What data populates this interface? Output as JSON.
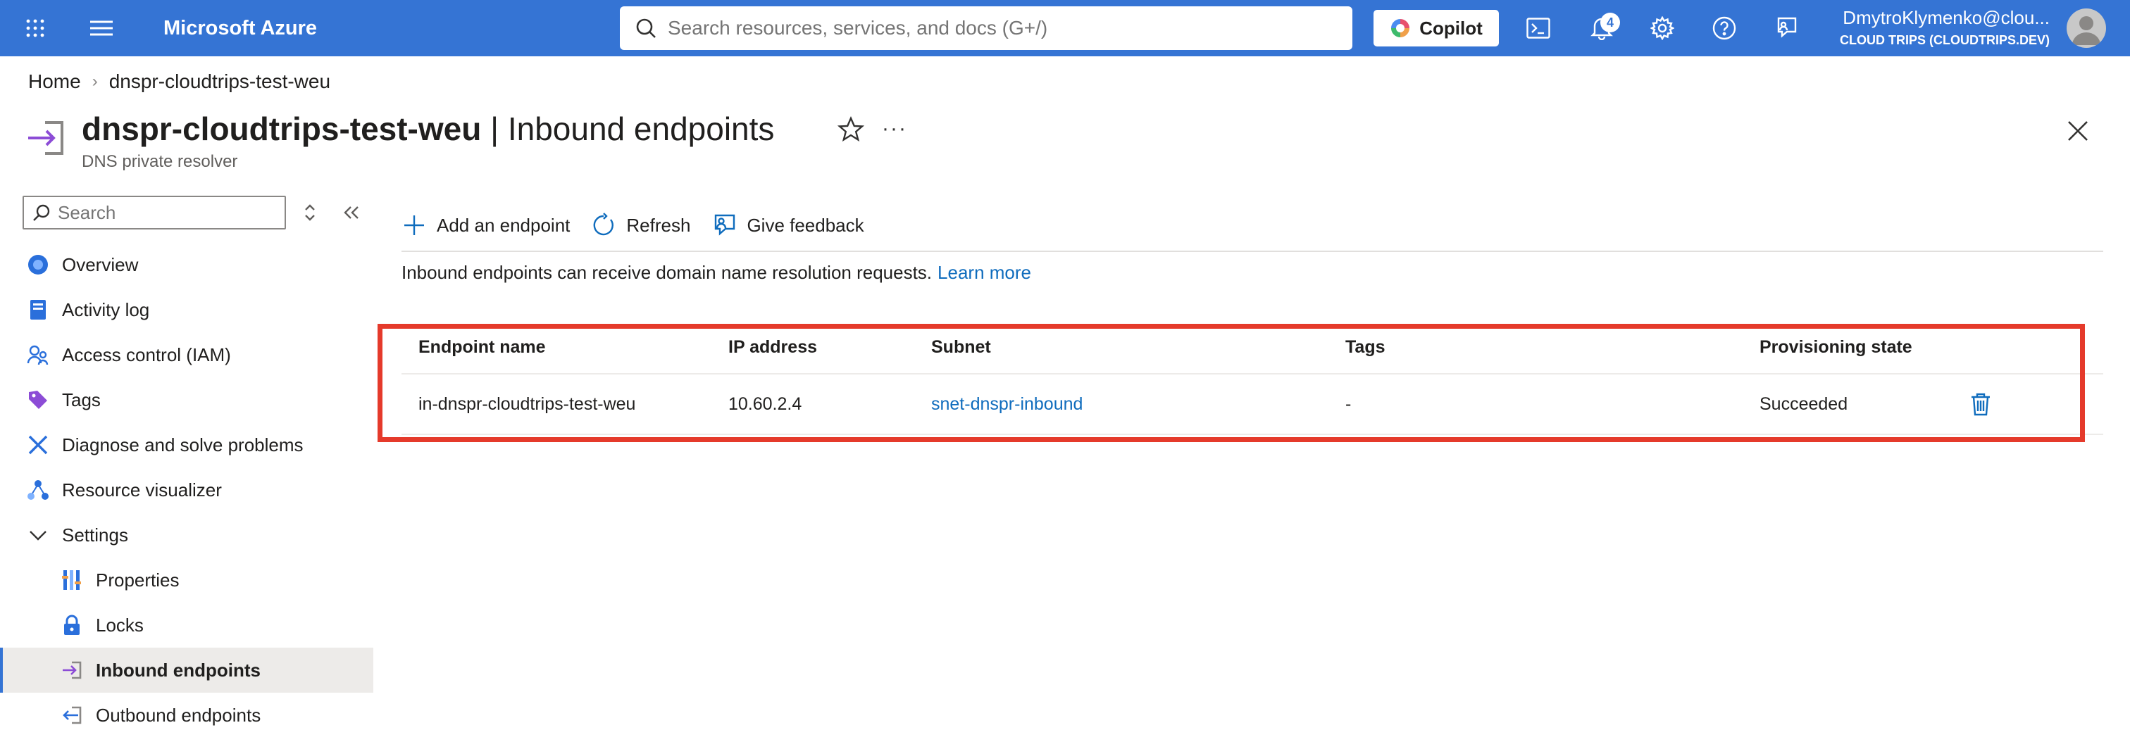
{
  "topbar": {
    "brand": "Microsoft Azure",
    "search_placeholder": "Search resources, services, and docs (G+/)",
    "copilot_label": "Copilot",
    "notification_count": "4",
    "user": "DmytroKlymenko@clou...",
    "tenant": "CLOUD TRIPS (CLOUDTRIPS.DEV)",
    "accent_color": "#3574d4"
  },
  "breadcrumb": {
    "home": "Home",
    "current": "dnspr-cloudtrips-test-weu"
  },
  "header": {
    "resource_name": "dnspr-cloudtrips-test-weu",
    "page_name": " | Inbound endpoints",
    "subtitle": "DNS private resolver"
  },
  "nav": {
    "search_placeholder": "Search",
    "items": [
      {
        "label": "Overview",
        "icon": "overview-icon"
      },
      {
        "label": "Activity log",
        "icon": "activity-log-icon"
      },
      {
        "label": "Access control (IAM)",
        "icon": "iam-icon"
      },
      {
        "label": "Tags",
        "icon": "tag-icon"
      },
      {
        "label": "Diagnose and solve problems",
        "icon": "wrench-icon"
      },
      {
        "label": "Resource visualizer",
        "icon": "visualizer-icon"
      },
      {
        "label": "Settings",
        "icon": "chevron-down-icon"
      },
      {
        "label": "Properties",
        "icon": "properties-icon"
      },
      {
        "label": "Locks",
        "icon": "lock-icon"
      },
      {
        "label": "Inbound endpoints",
        "icon": "inbound-icon"
      },
      {
        "label": "Outbound endpoints",
        "icon": "outbound-icon"
      }
    ]
  },
  "commands": {
    "add": "Add an endpoint",
    "refresh": "Refresh",
    "feedback": "Give feedback"
  },
  "info": {
    "text": "Inbound endpoints can receive domain name resolution requests.",
    "link": "Learn more"
  },
  "table": {
    "columns": [
      "Endpoint name",
      "IP address",
      "Subnet",
      "Tags",
      "Provisioning state"
    ],
    "rows": [
      {
        "name": "in-dnspr-cloudtrips-test-weu",
        "ip": "10.60.2.4",
        "subnet": "snet-dnspr-inbound",
        "tags": "-",
        "state": "Succeeded"
      }
    ]
  },
  "highlight_color": "#e53a2b"
}
